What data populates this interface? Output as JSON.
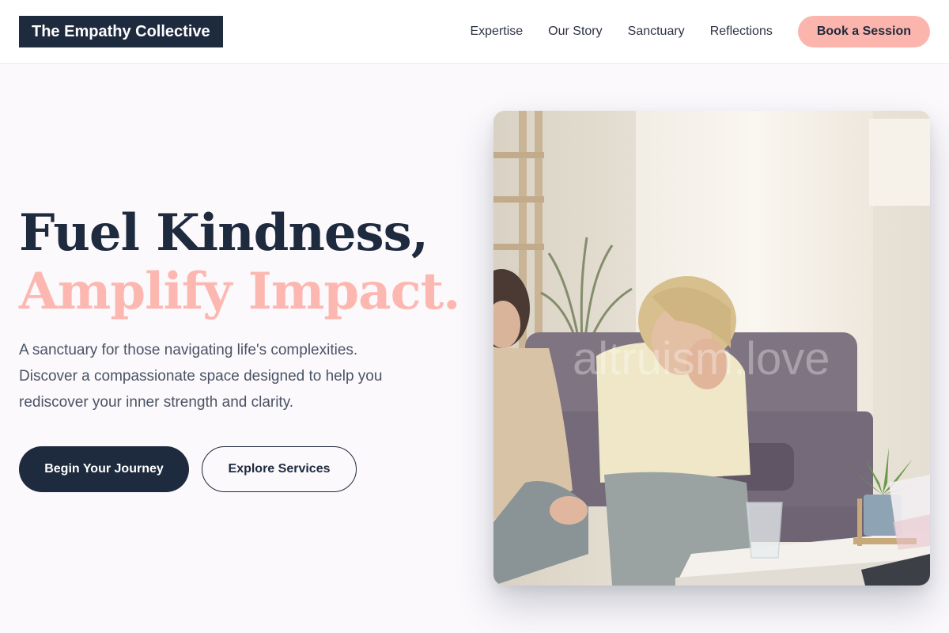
{
  "header": {
    "logo": "The Empathy Collective",
    "nav": [
      {
        "label": "Expertise"
      },
      {
        "label": "Our Story"
      },
      {
        "label": "Sanctuary"
      },
      {
        "label": "Reflections"
      }
    ],
    "cta_label": "Book a Session"
  },
  "hero": {
    "title_line1": "Fuel Kindness,",
    "title_line2": "Amplify Impact.",
    "description": "A sanctuary for those navigating life's complexities. Discover a compassionate space designed to help you rediscover your inner strength and clarity.",
    "primary_button": "Begin Your Journey",
    "secondary_button": "Explore Services"
  },
  "image": {
    "watermark": "altruism.love"
  },
  "colors": {
    "navy": "#1e2a3e",
    "accent_pink": "#fbb5ad",
    "background": "#fbf9fc",
    "body_text": "#4a5365"
  }
}
